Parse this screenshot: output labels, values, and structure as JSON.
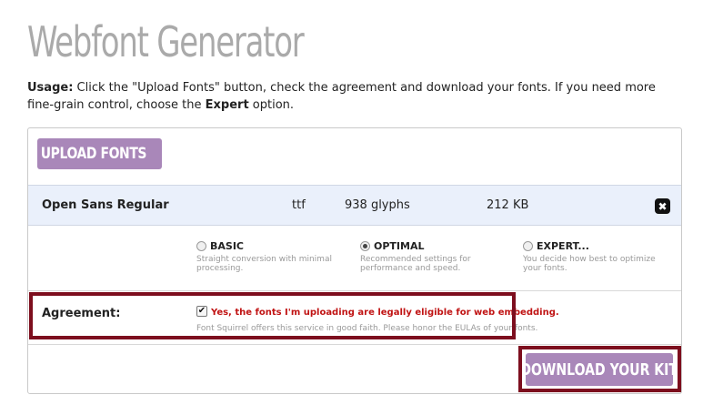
{
  "page": {
    "title": "Webfont Generator",
    "usage": {
      "prefix": "Usage:",
      "text1": " Click the \"Upload Fonts\" button, check the agreement and download your fonts. If you need more fine-grain control, choose the ",
      "expert": "Expert",
      "text2": " option."
    }
  },
  "upload": {
    "label": "UPLOAD FONTS",
    "arrow": "↑"
  },
  "file": {
    "name": "Open Sans Regular",
    "type": "ttf",
    "glyphs": "938 glyphs",
    "size": "212 KB",
    "remove_icon": "✖"
  },
  "options": [
    {
      "label": "BASIC",
      "desc": "Straight conversion with minimal processing.",
      "selected": false
    },
    {
      "label": "OPTIMAL",
      "desc": "Recommended settings for performance and speed.",
      "selected": true
    },
    {
      "label": "EXPERT...",
      "desc": "You decide how best to optimize your fonts.",
      "selected": false
    }
  ],
  "agreement": {
    "label": "Agreement:",
    "check": "✔",
    "text": "Yes, the fonts I'm uploading are legally eligible for web embedding.",
    "subtext": "Font Squirrel offers this service in good faith. Please honor the EULAs of your fonts."
  },
  "download": {
    "label": "DOWNLOAD YOUR KIT"
  },
  "colors": {
    "button_bg": "#a987b9",
    "highlight": "#7d0e1e",
    "agreement_text": "#c01313",
    "file_row_bg": "#eaf0fb",
    "title": "#aaaaaa"
  }
}
